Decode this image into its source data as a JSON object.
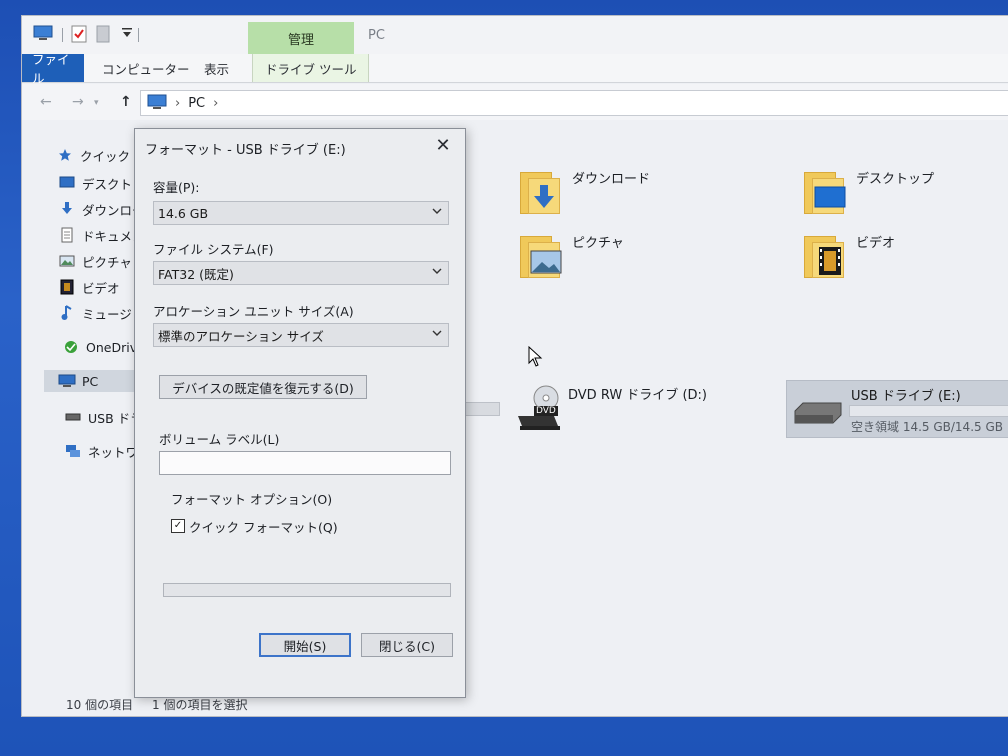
{
  "titlebar": {
    "manage_tab": "管理",
    "window_title": "PC"
  },
  "ribbon": {
    "file": "ファイル",
    "computer": "コンピューター",
    "view": "表示",
    "drive_tools": "ドライブ ツール"
  },
  "address": {
    "crumb": "PC"
  },
  "navpane": {
    "items": [
      {
        "label": "クイック ア",
        "icon": "star-icon"
      },
      {
        "label": "デスクトッ",
        "icon": "desktop-icon"
      },
      {
        "label": "ダウンロー",
        "icon": "download-icon"
      },
      {
        "label": "ドキュメン",
        "icon": "document-icon"
      },
      {
        "label": "ピクチャ",
        "icon": "picture-icon"
      },
      {
        "label": "ビデオ",
        "icon": "video-icon"
      },
      {
        "label": "ミュージッ",
        "icon": "music-icon"
      },
      {
        "label": "OneDrive",
        "icon": "onedrive-icon"
      },
      {
        "label": "PC",
        "icon": "pc-icon"
      },
      {
        "label": "USB ドライ",
        "icon": "usb-drive-icon"
      },
      {
        "label": "ネットワーク",
        "icon": "network-icon"
      }
    ]
  },
  "content": {
    "folders": [
      {
        "label": "ダウンロード",
        "icon": "downloads-folder-icon"
      },
      {
        "label": "デスクトップ",
        "icon": "desktop-folder-icon"
      },
      {
        "label": "ピクチャ",
        "icon": "pictures-folder-icon"
      },
      {
        "label": "ビデオ",
        "icon": "videos-folder-icon"
      }
    ],
    "dvd": {
      "label": "DVD RW ドライブ (D:)",
      "badge": "DVD"
    },
    "usb": {
      "label": "USB ドライブ (E:)",
      "free": "空き領域 14.5 GB/14.5 GB",
      "used_fraction": 0.0
    }
  },
  "status": {
    "count": "10 個の項目",
    "selected": "1 個の項目を選択"
  },
  "dialog": {
    "title": "フォーマット - USB ドライブ (E:)",
    "capacity_label": "容量(P):",
    "capacity_value": "14.6 GB",
    "fs_label": "ファイル システム(F)",
    "fs_value": "FAT32 (既定)",
    "alloc_label": "アロケーション ユニット サイズ(A)",
    "alloc_value": "標準のアロケーション サイズ",
    "restore_button": "デバイスの既定値を復元する(D)",
    "volume_label": "ボリューム ラベル(L)",
    "volume_value": "",
    "options_label": "フォーマット オプション(O)",
    "quick_format_label": "クイック フォーマット(Q)",
    "quick_format_checked": true,
    "progress": 0,
    "start_button": "開始(S)",
    "close_button": "閉じる(C)"
  }
}
